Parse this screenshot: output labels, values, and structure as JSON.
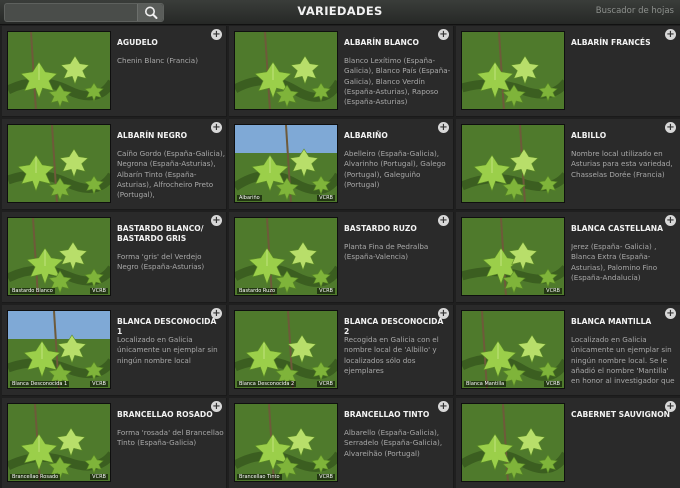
{
  "header": {
    "title": "VARIEDADES",
    "search_placeholder": "",
    "right_link": "Buscador de hojas"
  },
  "cards": [
    {
      "name": "AGUDELO",
      "desc": "Chenin Blanc (Francia)",
      "caption": "",
      "mark": "",
      "sky": false
    },
    {
      "name": "ALBARÍN BLANCO",
      "desc": "Blanco Lexítimo (España-Galicia), Blanco País (España-Galicia), Blanco Verdín (España-Asturias), Raposo (España-Asturias)",
      "caption": "",
      "mark": "",
      "sky": false
    },
    {
      "name": "ALBARÍN FRANCÉS",
      "desc": "",
      "caption": "",
      "mark": "",
      "sky": false
    },
    {
      "name": "ALBARÍN NEGRO",
      "desc": "Caíño Gordo (España-Galicia), Negrona (España-Asturias), Albarín Tinto (España-Asturias), Alfrocheiro Preto (Portugal),",
      "caption": "",
      "mark": "",
      "sky": false
    },
    {
      "name": "ALBARIÑO",
      "desc": "Abelleiro (España-Galicia), Alvarinho (Portugal), Galego (Portugal), Galeguiño (Portugal)",
      "caption": "Albariño",
      "mark": "VCRB",
      "sky": true
    },
    {
      "name": "ALBILLO",
      "desc": "Nombre local utilizado en Asturias para esta variedad, Chasselas Dorée (Francia)",
      "caption": "",
      "mark": "",
      "sky": false
    },
    {
      "name": "BASTARDO BLANCO/ BASTARDO GRIS",
      "desc": "Forma 'gris' del Verdejo Negro (España-Asturias)",
      "caption": "Bastardo Blanco",
      "mark": "VCRB",
      "sky": false
    },
    {
      "name": "BASTARDO RUZO",
      "desc": "Planta Fina de Pedralba (España-Valencia)",
      "caption": "Bastardo Ruzo",
      "mark": "VCRB",
      "sky": false
    },
    {
      "name": "BLANCA CASTELLANA",
      "desc": "Jerez (España- Galicia) , Blanca Extra (España-Asturias), Palomino Fino (España-Andalucía)",
      "caption": "",
      "mark": "VCRB",
      "sky": false
    },
    {
      "name": "BLANCA DESCONOCIDA 1",
      "desc": "Localizado en Galicia únicamente un ejemplar sin ningún nombre local",
      "caption": "Blanca Desconocida 1",
      "mark": "VCRB",
      "sky": true
    },
    {
      "name": "BLANCA DESCONOCIDA 2",
      "desc": "Recogida en Galicia con el nombre local de 'Albillo' y localizados sólo dos ejemplares",
      "caption": "Blanca Desconocida 2",
      "mark": "VCRB",
      "sky": false
    },
    {
      "name": "BLANCA MANTILLA",
      "desc": "Localizado en Galicia únicamente un ejemplar sin ningún nombre local. Se le añadió el nombre 'Mantilla' en honor al investigador que",
      "caption": "Blanca Mantilla",
      "mark": "VCRB",
      "sky": false
    },
    {
      "name": "BRANCELLAO ROSADO",
      "desc": "Forma 'rosada' del Brancellao Tinto (España-Galicia)",
      "caption": "Brancellao Rosado",
      "mark": "VCRB",
      "sky": false
    },
    {
      "name": "BRANCELLAO TINTO",
      "desc": "Albarello (España-Galicia), Serradelo (España-Galicia), Alvareihão (Portugal)",
      "caption": "Brancellao Tinto",
      "mark": "VCRB",
      "sky": false
    },
    {
      "name": "CABERNET SAUVIGNON",
      "desc": "",
      "caption": "",
      "mark": "",
      "sky": false
    }
  ],
  "add_symbol": "+",
  "colors": {
    "background": "#1f1f1f",
    "card": "#2a2a2a",
    "leaf": "#9bcf4a",
    "foliage": "#4f7a2c"
  },
  "icons": {
    "search": "search-icon",
    "add": "plus-circle-icon"
  }
}
